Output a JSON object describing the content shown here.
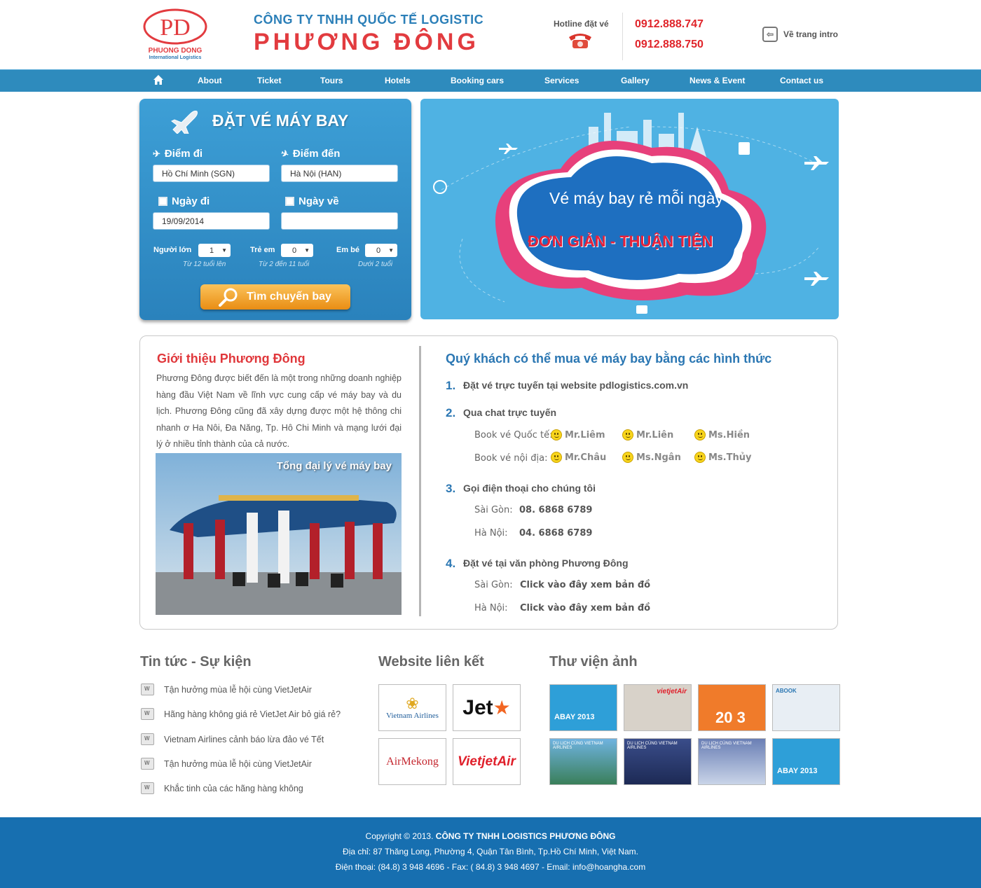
{
  "header": {
    "company_line1": "CÔNG TY TNHH QUỐC TẾ LOGISTIC",
    "company_line2": "PHƯƠNG ĐÔNG",
    "logo_text": "PD",
    "logo_sub": "PHUONG DONG",
    "logo_sub2": "International Logistics",
    "hotline_label": "Hotline đặt vé",
    "hotline1": "0912.888.747",
    "hotline2": "0912.888.750",
    "intro_link": "Về trang intro",
    "intro_icon": "back-arrow-icon"
  },
  "nav": {
    "home_icon": "home-icon",
    "items": [
      "About",
      "Ticket",
      "Tours",
      "Hotels",
      "Booking cars",
      "Services",
      "Gallery",
      "News & Event",
      "Contact us"
    ]
  },
  "booking": {
    "title": "ĐẶT VÉ MÁY BAY",
    "from_label": "Điểm đi",
    "to_label": "Điểm đến",
    "from_value": "Hồ Chí Minh (SGN)",
    "to_value": "Hà Nội (HAN)",
    "depart_label": "Ngày đi",
    "return_label": "Ngày về",
    "depart_value": "19/09/2014",
    "return_value": "",
    "adult_label": "Người lớn",
    "child_label": "Trẻ em",
    "infant_label": "Em bé",
    "adult_value": "1",
    "child_value": "0",
    "infant_value": "0",
    "adult_hint": "Từ 12 tuổi lên",
    "child_hint": "Từ 2 đến 11 tuổi",
    "infant_hint": "Dưới 2 tuổi",
    "search_button": "Tìm chuyến bay"
  },
  "banner": {
    "line1": "Vé máy bay rẻ mỗi ngày",
    "line2": "ĐƠN GIẢN - THUẬN TIỆN"
  },
  "about": {
    "title": "Giới thiệu Phương Đông",
    "text": "Phương Đông được biết đến là một trong những doanh nghiệp hàng đầu Việt Nam về lĩnh vực cung cấp vé máy bay và du lịch. Phương Đông cũng đã xây dựng được một hệ thông chi nhanh ơ Ha Nôi, Đa Năng, Tp. Hô Chi Minh và mạng lưới đại lý ở nhiều tỉnh thành của cả nước.",
    "image_caption": "Tổng đại lý vé máy bay"
  },
  "methods": {
    "title": "Quý khách có thể mua vé máy bay bằng các hình thức",
    "m1": {
      "num": "1.",
      "text": "Đặt vé trực tuyến tại website pdlogistics.com.vn"
    },
    "m2": {
      "num": "2.",
      "text": "Qua chat trực tuyến",
      "intl_label": "Book vé Quốc tế:",
      "dom_label": "Book vé nội địa:",
      "intl": [
        "Mr.Liêm",
        "Mr.Liên",
        "Ms.Hiền"
      ],
      "dom": [
        "Mr.Châu",
        "Ms.Ngân",
        "Ms.Thủy"
      ]
    },
    "m3": {
      "num": "3.",
      "text": "Gọi điện thoại cho chúng tôi",
      "sg_label": "Sài Gòn:",
      "sg_value": "08. 6868 6789",
      "hn_label": "Hà Nội:",
      "hn_value": "04. 6868 6789"
    },
    "m4": {
      "num": "4.",
      "text": "Đặt vé tại văn phòng Phương Đông",
      "sg_label": "Sài Gòn:",
      "sg_value": "Click vào đây xem bản đồ",
      "hn_label": "Hà Nội:",
      "hn_value": "Click vào đây xem bản đồ"
    }
  },
  "news": {
    "title": "Tin tức - Sự kiện",
    "items": [
      "Tận hưởng mùa lễ hội cùng VietJetAir",
      "Hãng hàng không giá rẻ VietJet Air bỏ giá rẻ?",
      "Vietnam Airlines cảnh báo lừa đảo vé Tết",
      "Tận hưởng mùa lễ hội cùng VietJetAir",
      "Khắc tinh của các hãng hàng không"
    ]
  },
  "links": {
    "title": "Website liên kết",
    "partners": [
      "Vietnam Airlines",
      "Jet",
      "AirMekong",
      "VietjetAir"
    ]
  },
  "gallery": {
    "title": "Thư viện ảnh",
    "thumbs": [
      {
        "label": "ABAY 2013"
      },
      {
        "label": "vietjetAir"
      },
      {
        "label": "20 3"
      },
      {
        "label": "ABOOK"
      },
      {
        "label": "DU LỊCH CÙNG VIETNAM AIRLINES"
      },
      {
        "label": "DU LỊCH CÙNG VIETNAM AIRLINES"
      },
      {
        "label": "DU LỊCH CÙNG VIETNAM AIRLINES"
      },
      {
        "label": "ABAY 2013"
      }
    ]
  },
  "footer": {
    "copyright_prefix": "Copyright © 2013.",
    "copyright_company": "CÔNG TY TNHH LOGISTICS PHƯƠNG ĐÔNG",
    "address": "Địa chỉ: 87 Thăng Long, Phường 4, Quận Tân Bình, Tp.Hồ Chí Minh, Việt Nam.",
    "contact": "Điện thoại: (84.8) 3 948 4696 - Fax: ( 84.8) 3 948 4697 - Email: info@hoangha.com"
  },
  "colors": {
    "primary_blue": "#2e8bbd",
    "accent_red": "#e23b3f",
    "footer_blue": "#176fb0",
    "button_orange": "#f0a030"
  }
}
